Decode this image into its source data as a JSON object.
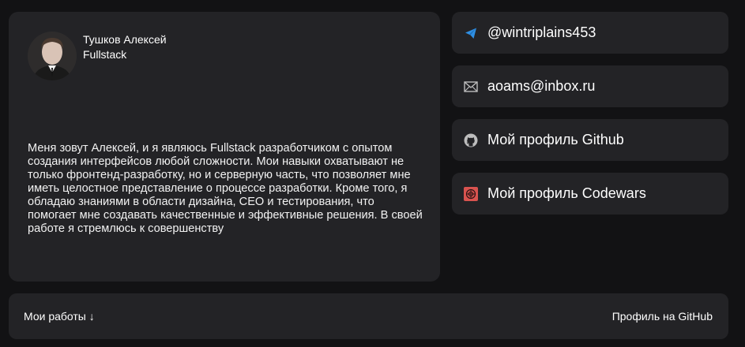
{
  "profile": {
    "name": "Тушков Алексей",
    "role": "Fullstack",
    "bio": "Меня зовут Алексей, и я являюсь Fullstack разработчиком с опытом создания интерфейсов любой сложности. Мои навыки охватывают не только фронтенд-разработку, но и серверную часть, что позволяет мне иметь целостное представление о процессе разработки. Кроме того, я обладаю знаниями в области дизайна, СЕО и тестирования, что помогает мне создавать качественные и эффективные решения. В своей работе я стремлюсь к совершенству"
  },
  "contacts": [
    {
      "label": "@wintriplains453",
      "icon": "telegram-icon",
      "color": "#2f8fe3"
    },
    {
      "label": "aoams@inbox.ru",
      "icon": "mail-icon",
      "color": "#bdbdbd"
    },
    {
      "label": "Мой профиль Github",
      "icon": "github-icon",
      "color": "#bdbdbd"
    },
    {
      "label": "Мой профиль Codewars",
      "icon": "codewars-icon",
      "color": "#d9534f"
    }
  ],
  "footer": {
    "works_label": "Мои работы ↓",
    "github_label": "Профиль на GitHub"
  },
  "colors": {
    "background": "#121214",
    "card": "#232326",
    "text": "#ffffff"
  }
}
